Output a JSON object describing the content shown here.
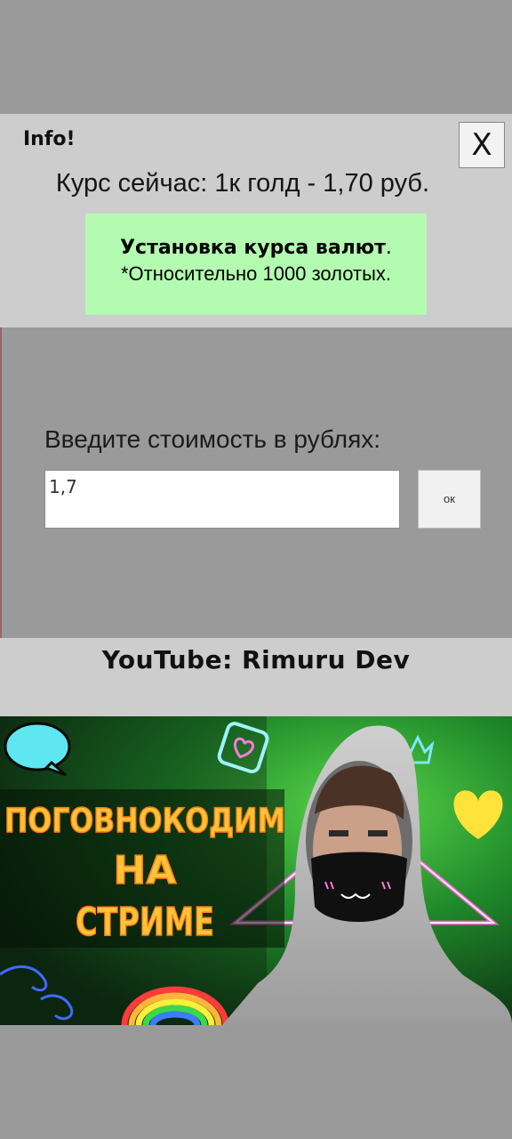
{
  "dialog": {
    "title": "Info!",
    "close_label": "X",
    "rate_text": "Курс сейчас: 1к голд - 1,70 руб.",
    "notice_bold": "Установка курса валют",
    "notice_dot": ".",
    "notice_line2": "*Относительно 1000 золотых."
  },
  "form": {
    "prompt": "Введите стоимость в рублях:",
    "input_value": "1,7",
    "ok_label": "ок"
  },
  "footer": {
    "channel_text": "YouTube: Rimuru Dev"
  },
  "thumbnail": {
    "headline_lines": [
      "ПОГОВНОКОДИМ",
      "НА",
      "СТРИМЕ"
    ]
  },
  "colors": {
    "panel": "#cdcdcd",
    "background": "#9a9a9a",
    "notice_bg": "#b3fbb0",
    "headline": "#ffc23a"
  }
}
